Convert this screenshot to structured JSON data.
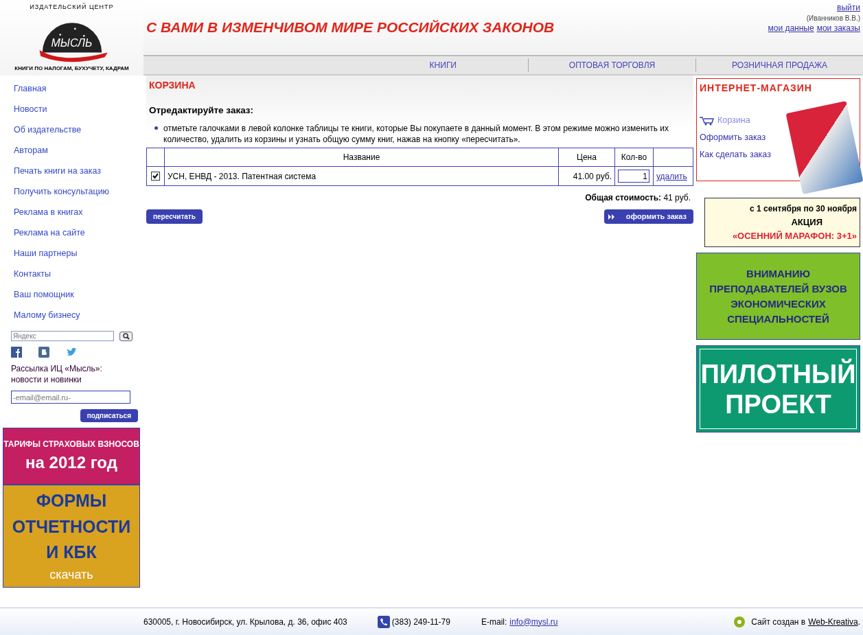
{
  "logo": {
    "arc_text": "ИЗДАТЕЛЬСКИЙ ЦЕНТР",
    "name": "МЫСЛЬ",
    "tagline": "КНИГИ ПО НАЛОГАМ,  БУХУЧЕТУ, КАДРАМ"
  },
  "slogan": "С ВАМИ В ИЗМЕНЧИВОМ МИРЕ РОССИЙСКИХ  ЗАКОНОВ",
  "user": {
    "logout": "выйти",
    "name": "(Иванников В.В.)",
    "links": [
      "мои данные",
      "мои заказы"
    ]
  },
  "top_nav": [
    "КНИГИ",
    "ОПТОВАЯ ТОРГОВЛЯ",
    "РОЗНИЧНАЯ ПРОДАЖА"
  ],
  "sidebar": {
    "items": [
      "Главная",
      "Новости",
      "Об издательстве",
      "Авторам",
      "Печать книги на заказ",
      "Получить консультацию",
      "Реклама в книгах",
      "Реклама на сайте",
      "Наши партнеры",
      "Контакты",
      "Ваш помощник",
      "Малому бизнесу"
    ],
    "search": {
      "placeholder": "Яндекс"
    },
    "newsletter": {
      "title": "Рассылка ИЦ «Мысль»:",
      "subtitle": "новости и новинки",
      "placeholder": "-email@email.ru-",
      "button": "подписаться"
    },
    "banners": [
      {
        "lines": [
          "ТАРИФЫ СТРАХОВЫХ ВЗНОСОВ",
          "на 2012 год"
        ],
        "color": "#c41f62"
      },
      {
        "lines": [
          "ФОРМЫ",
          "ОТЧЕТНОСТИ",
          "И КБК",
          "скачать"
        ],
        "color": "#d9a21f"
      }
    ]
  },
  "cart": {
    "title": "КОРЗИНА",
    "subtitle": "Отредактируйте заказ:",
    "note": "отметьте галочками в левой колонке таблицы те книги, которые Вы покупаете в данный момент. В этом режиме можно изменить их количество, удалить из корзины и узнать общую сумму книг, нажав на кнопку «пересчитать».",
    "columns": [
      "Название",
      "Цена",
      "Кол-во"
    ],
    "rows": [
      {
        "checked": true,
        "title": "УСН, ЕНВД - 2013. Патентная система",
        "price": "41.00 руб.",
        "qty": "1",
        "delete": "удалить"
      }
    ],
    "total_label": "Общая стоимость:",
    "total": "41 руб.",
    "recalc": "пересчитать",
    "checkout": "оформить заказ"
  },
  "shop": {
    "title": "ИНТЕРНЕТ-МАГАЗИН",
    "links": [
      {
        "label": "Корзина",
        "selected": true
      },
      {
        "label": "Оформить заказ",
        "selected": false
      },
      {
        "label": "Как сделать заказ",
        "selected": false
      }
    ]
  },
  "promos": [
    {
      "kind": "promo",
      "lines": [
        "с 1 сентября по 30 ноября",
        "АКЦИЯ",
        "«ОСЕННИЙ МАРАФОН: 3+1»"
      ]
    },
    {
      "kind": "green",
      "lines": [
        "ВНИМАНИЮ",
        "ПРЕПОДАВАТЕЛЕЙ ВУЗОВ",
        "ЭКОНОМИЧЕСКИХ",
        "СПЕЦИАЛЬНОСТЕЙ"
      ]
    },
    {
      "kind": "pilot",
      "lines": [
        "ПИЛОТНЫЙ",
        "ПРОЕКТ"
      ]
    }
  ],
  "footer": {
    "address": "630005, г. Новосибирск, ул. Крылова, д. 36, офис 403",
    "phone": "(383) 249-11-79",
    "email_label": "E-mail:",
    "email": "info@mysl.ru",
    "credit": "Сайт создан в",
    "credit_link": "Web-Kreativa",
    "credit_end": "."
  }
}
